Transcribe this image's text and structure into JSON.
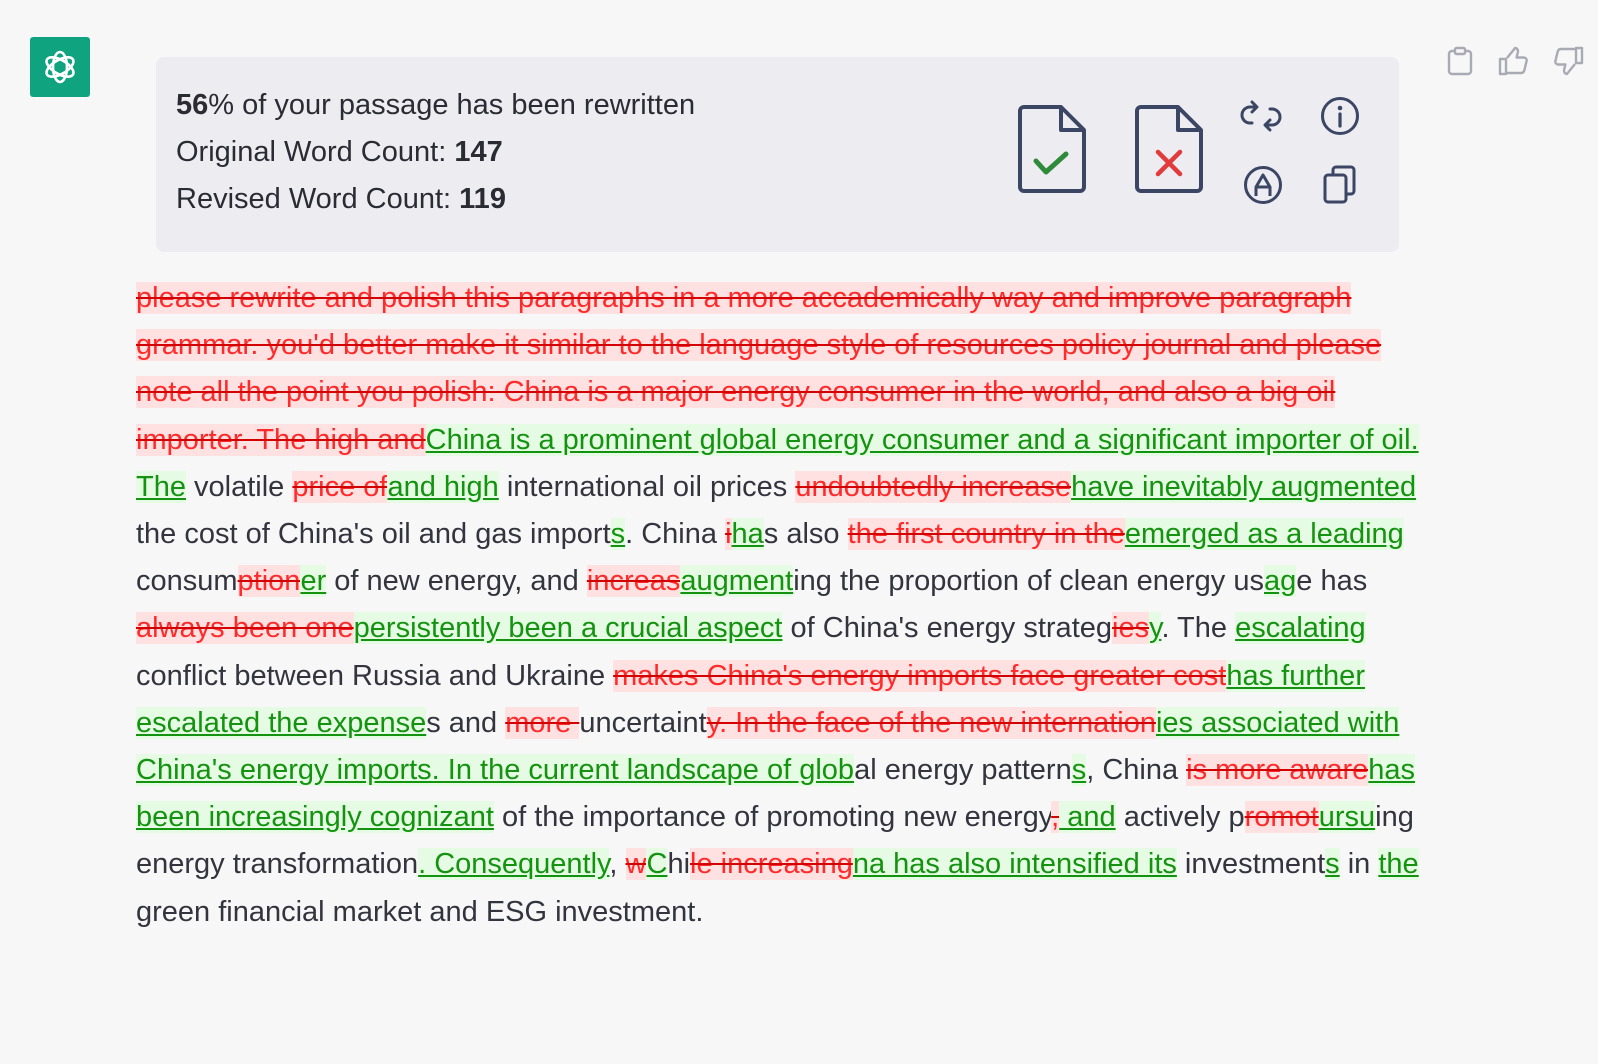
{
  "stats": {
    "percent": "56",
    "percent_suffix": "% of your passage has been rewritten",
    "original_label": "Original Word Count: ",
    "original_value": "147",
    "revised_label": "Revised Word Count: ",
    "revised_value": "119"
  },
  "passage": [
    {
      "t": "del",
      "s": "please rewrite and polish this paragraphs in a more accademically way and improve paragraph grammar. you'd better make it similar to the language style of resources policy journal and please note all the point you polish:  China is a major energy consumer in the world, and also a big oil importer. The high and"
    },
    {
      "t": "ins",
      "s": "China is a prominent global energy consumer and a significant importer of oil. The"
    },
    {
      "t": "eq",
      "s": " volatile "
    },
    {
      "t": "del",
      "s": "price of"
    },
    {
      "t": "ins",
      "s": "and high"
    },
    {
      "t": "eq",
      "s": " international oil prices "
    },
    {
      "t": "del",
      "s": "undoubtedly increase"
    },
    {
      "t": "ins",
      "s": "have inevitably augmented"
    },
    {
      "t": "eq",
      "s": " the cost of China's oil and gas import"
    },
    {
      "t": "ins",
      "s": "s"
    },
    {
      "t": "eq",
      "s": ". China "
    },
    {
      "t": "del",
      "s": "i"
    },
    {
      "t": "ins",
      "s": "ha"
    },
    {
      "t": "eq",
      "s": "s also "
    },
    {
      "t": "del",
      "s": "the first country in the"
    },
    {
      "t": "ins",
      "s": "emerged as a leading"
    },
    {
      "t": "eq",
      "s": " consum"
    },
    {
      "t": "del",
      "s": "ption"
    },
    {
      "t": "ins",
      "s": "er"
    },
    {
      "t": "eq",
      "s": " of new energy, and "
    },
    {
      "t": "del",
      "s": "increas"
    },
    {
      "t": "ins",
      "s": "augment"
    },
    {
      "t": "eq",
      "s": "ing the proportion of clean energy us"
    },
    {
      "t": "ins",
      "s": "ag"
    },
    {
      "t": "eq",
      "s": "e has "
    },
    {
      "t": "del",
      "s": "always been one"
    },
    {
      "t": "ins",
      "s": "persistently been a crucial aspect"
    },
    {
      "t": "eq",
      "s": " of China's energy strateg"
    },
    {
      "t": "del",
      "s": "ies"
    },
    {
      "t": "ins",
      "s": "y"
    },
    {
      "t": "eq",
      "s": ". The "
    },
    {
      "t": "ins",
      "s": "escalating "
    },
    {
      "t": "eq",
      "s": "conflict between Russia and Ukraine "
    },
    {
      "t": "del",
      "s": "makes China's energy imports face greater cost"
    },
    {
      "t": "ins",
      "s": "has further escalated the expense"
    },
    {
      "t": "eq",
      "s": "s and "
    },
    {
      "t": "del",
      "s": "more "
    },
    {
      "t": "eq",
      "s": "uncertaint"
    },
    {
      "t": "del",
      "s": "y. In the face of the new internation"
    },
    {
      "t": "ins",
      "s": "ies associated with China's energy imports. In the current landscape of glob"
    },
    {
      "t": "eq",
      "s": "al energy pattern"
    },
    {
      "t": "ins",
      "s": "s"
    },
    {
      "t": "eq",
      "s": ", China "
    },
    {
      "t": "del",
      "s": "is more aware"
    },
    {
      "t": "ins",
      "s": "has been increasingly cognizant"
    },
    {
      "t": "eq",
      "s": " of the importance of promoting new energy"
    },
    {
      "t": "del",
      "s": ","
    },
    {
      "t": "ins",
      "s": " and"
    },
    {
      "t": "eq",
      "s": " actively p"
    },
    {
      "t": "del",
      "s": "romot"
    },
    {
      "t": "ins",
      "s": "ursu"
    },
    {
      "t": "eq",
      "s": "ing energy transformation"
    },
    {
      "t": "ins",
      "s": ". Consequently"
    },
    {
      "t": "eq",
      "s": ", "
    },
    {
      "t": "del",
      "s": "w"
    },
    {
      "t": "ins",
      "s": "C"
    },
    {
      "t": "eq",
      "s": "hi"
    },
    {
      "t": "del",
      "s": "le increasing"
    },
    {
      "t": "ins",
      "s": "na has also intensified its"
    },
    {
      "t": "eq",
      "s": " investment"
    },
    {
      "t": "ins",
      "s": "s"
    },
    {
      "t": "eq",
      "s": " in "
    },
    {
      "t": "ins",
      "s": "the "
    },
    {
      "t": "eq",
      "s": "green financial market and ESG investment."
    }
  ],
  "colors": {
    "avatar_bg": "#10a37f",
    "deleted_text": "#ff2a2a",
    "deleted_bg": "#ffe1e1",
    "inserted_text": "#13930f",
    "inserted_bg": "#e6fbe3"
  },
  "icons": {
    "top_actions": [
      "clipboard-icon",
      "thumbs-up-icon",
      "thumbs-down-icon"
    ],
    "tools": [
      "accept-document-icon",
      "reject-document-icon",
      "regenerate-icon",
      "info-icon",
      "highlighter-icon",
      "copy-icon"
    ]
  }
}
